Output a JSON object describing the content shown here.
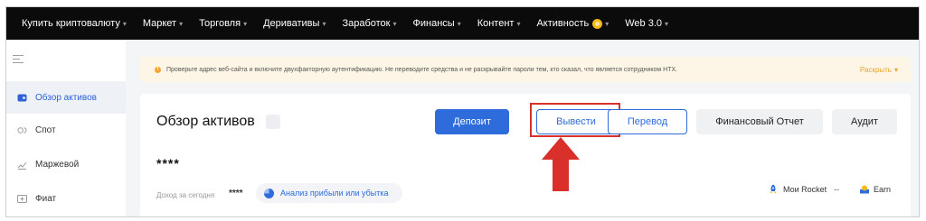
{
  "topnav": {
    "items": [
      {
        "label": "Купить криптовалюту",
        "caret": true
      },
      {
        "label": "Маркет",
        "caret": true
      },
      {
        "label": "Торговля",
        "caret": true
      },
      {
        "label": "Деривативы",
        "caret": true
      },
      {
        "label": "Заработок",
        "caret": true
      },
      {
        "label": "Финансы",
        "caret": true
      },
      {
        "label": "Контент",
        "caret": true
      },
      {
        "label": "Активность",
        "caret": true,
        "badge": "coin-icon"
      },
      {
        "label": "Web 3.0",
        "caret": true
      }
    ]
  },
  "sidebar": {
    "items": [
      {
        "label": "Обзор активов",
        "active": true
      },
      {
        "label": "Спот"
      },
      {
        "label": "Маржевой"
      },
      {
        "label": "Фиат"
      }
    ]
  },
  "notice": {
    "text": "Проверьте адрес веб-сайта и включите двухфакторную аутентификацию. Не переводите средства и не раскрывайте пароли тем, кто сказал, что является сотрудником HTX.",
    "expand_label": "Раскрыть"
  },
  "overview": {
    "title": "Обзор активов",
    "buttons": {
      "deposit": "Депозит",
      "withdraw": "Вывести",
      "transfer": "Перевод",
      "report": "Финансовый Отчет",
      "audit": "Аудит"
    },
    "balance_masked": "****",
    "today_label": "Доход за сегодня",
    "today_value": "****",
    "pnl_link": "Анализ прибыли или убытка",
    "rocket_label": "Мои Rocket",
    "rocket_value": "--",
    "earn_label": "Earn"
  },
  "colors": {
    "accent": "#2e6bdb",
    "highlight": "#d9302c",
    "nav_bg": "#0b0b0b",
    "notice_bg": "#fdf6e6"
  }
}
